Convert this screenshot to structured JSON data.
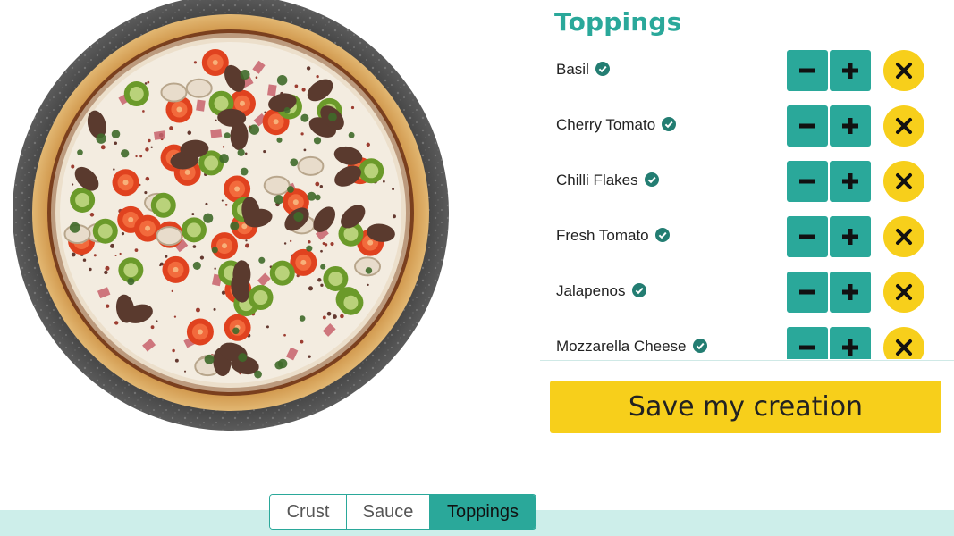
{
  "toppings_panel": {
    "title": "Toppings",
    "items": [
      {
        "label": "Basil"
      },
      {
        "label": "Cherry Tomato"
      },
      {
        "label": "Chilli Flakes"
      },
      {
        "label": "Fresh Tomato"
      },
      {
        "label": "Jalapenos"
      },
      {
        "label": "Mozzarella Cheese"
      }
    ],
    "icons": {
      "selected": "check-circle-icon",
      "decrease": "minus-icon",
      "increase": "plus-icon",
      "remove": "close-icon"
    }
  },
  "save_button": {
    "label": "Save my creation"
  },
  "tabs": [
    {
      "label": "Crust",
      "active": false
    },
    {
      "label": "Sauce",
      "active": false
    },
    {
      "label": "Toppings",
      "active": true
    }
  ],
  "colors": {
    "accent_teal": "#2aa89a",
    "accent_yellow": "#f7cf1b",
    "band": "#cdeeea",
    "text": "#222222"
  }
}
